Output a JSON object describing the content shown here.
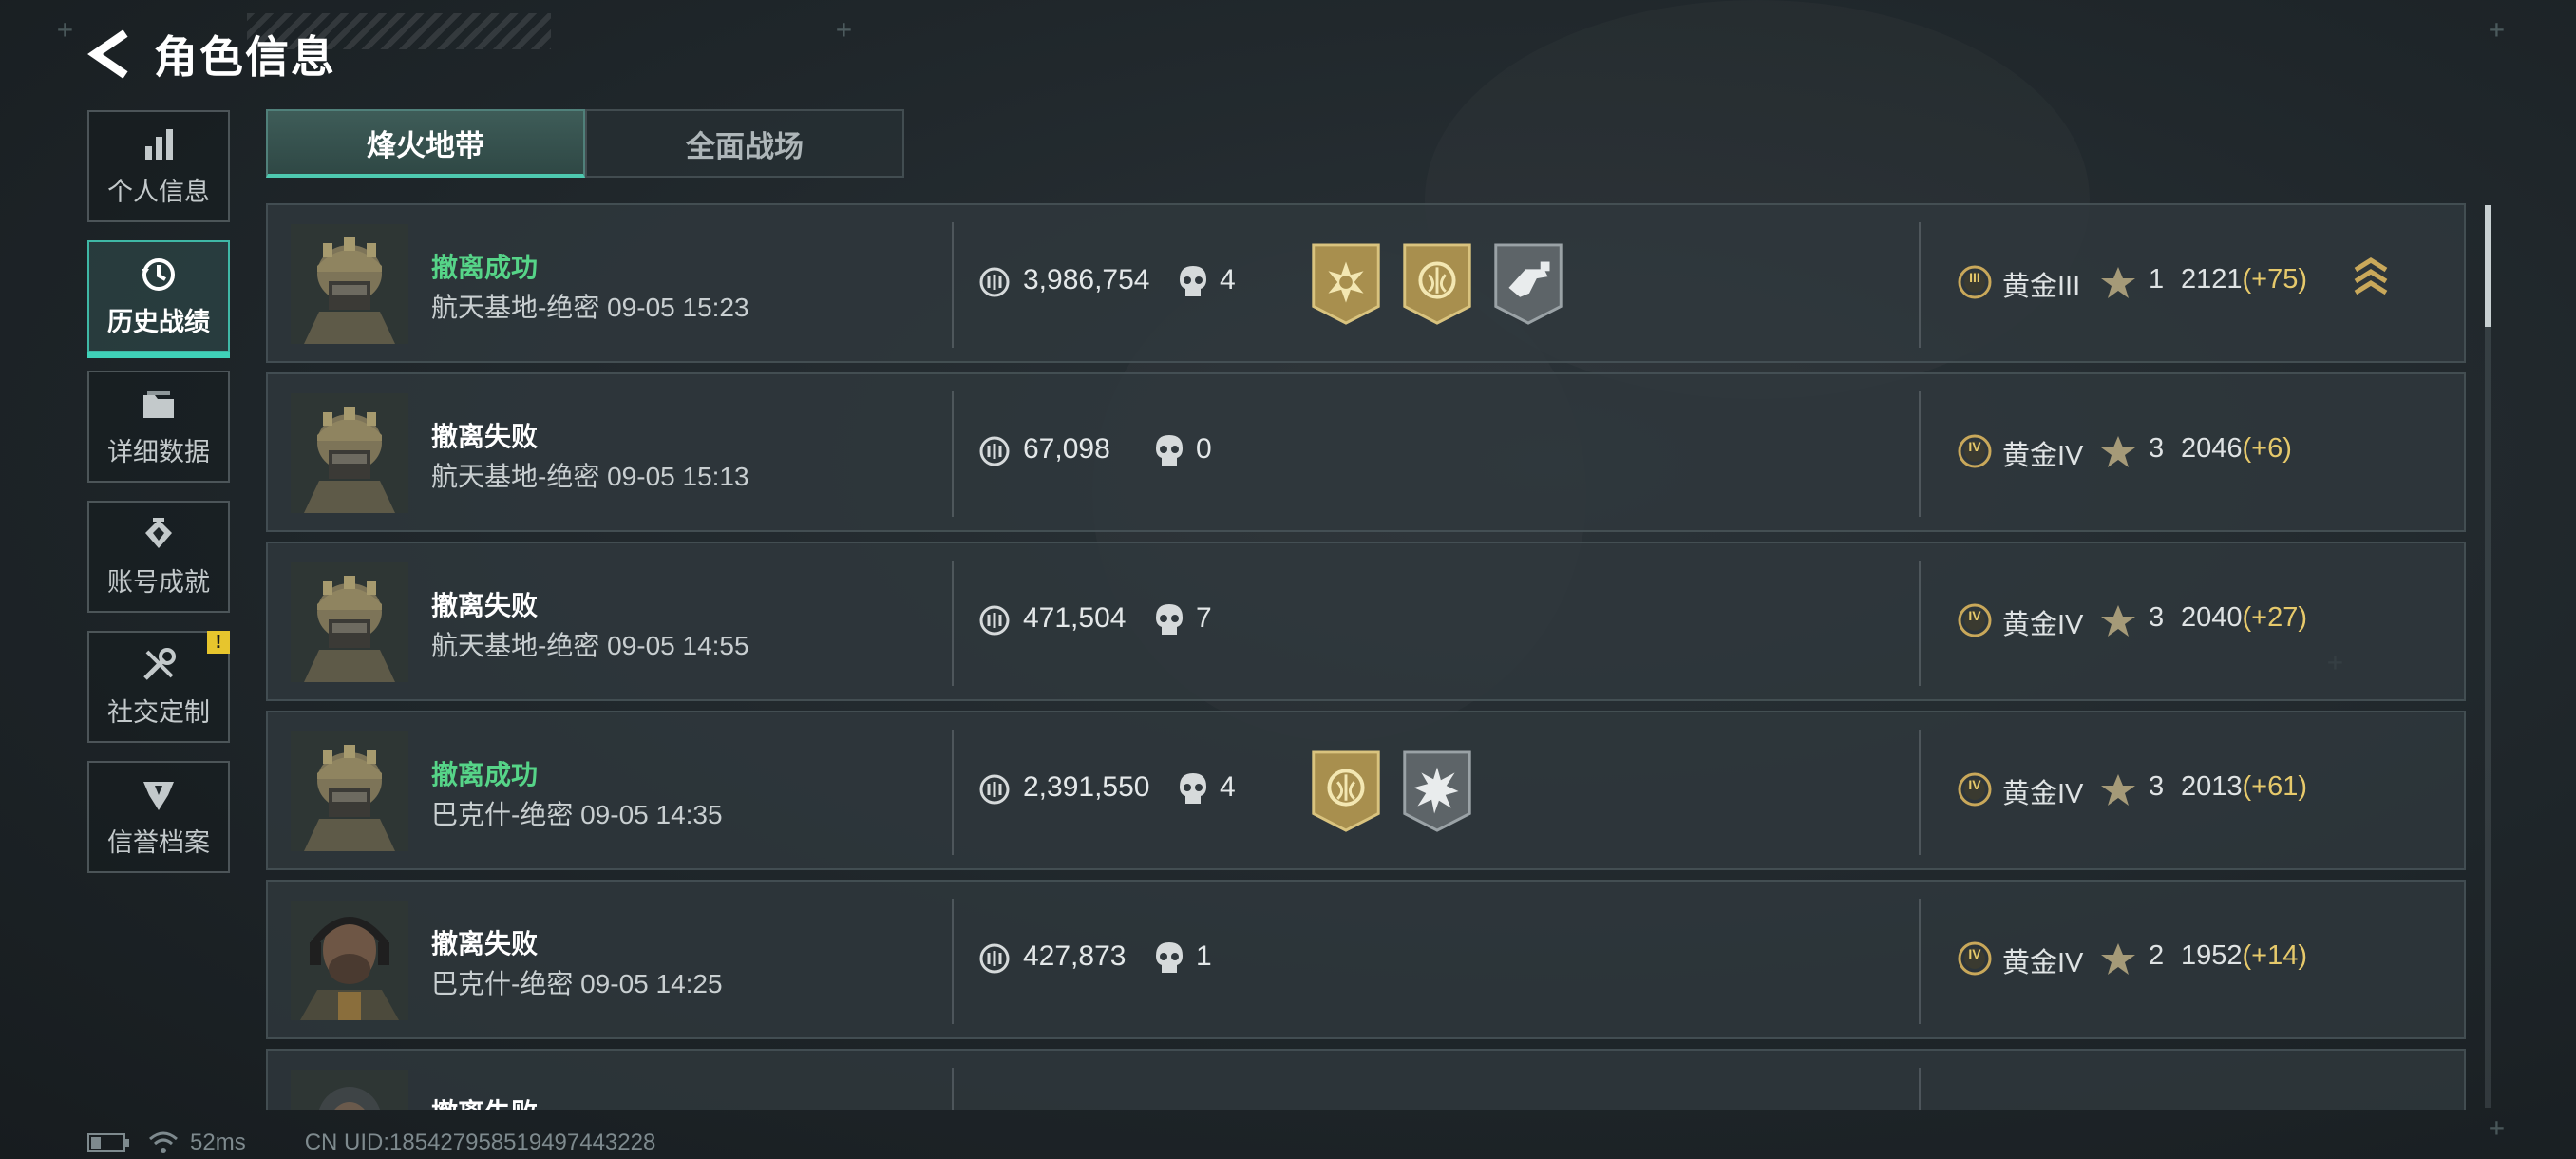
{
  "header": {
    "title": "角色信息"
  },
  "sidebar": {
    "items": [
      {
        "label": "个人信息",
        "icon": "bar-chart-icon"
      },
      {
        "label": "历史战绩",
        "icon": "history-clock-icon",
        "active": true
      },
      {
        "label": "详细数据",
        "icon": "folder-icon"
      },
      {
        "label": "账号成就",
        "icon": "achievement-icon"
      },
      {
        "label": "社交定制",
        "icon": "tools-icon",
        "badge": "!"
      },
      {
        "label": "信誉档案",
        "icon": "shield-emblem-icon"
      }
    ]
  },
  "tabs": [
    {
      "label": "烽火地带",
      "active": true
    },
    {
      "label": "全面战场",
      "active": false
    }
  ],
  "matches": [
    {
      "status": "撤离成功",
      "success": true,
      "map_time": "航天基地-绝密 09-05 15:23",
      "value": "3,986,754",
      "kills": "4",
      "badges": [
        "gold-sun-badge",
        "gold-emblem-badge",
        "grey-weapon-badge"
      ],
      "rank": "黄金III",
      "rank_numeral": "III",
      "stars": "1",
      "score": "2121",
      "delta": "(+75)",
      "rank_up": true,
      "avatar": "helmet-soldier"
    },
    {
      "status": "撤离失败",
      "success": false,
      "map_time": "航天基地-绝密 09-05 15:13",
      "value": "67,098",
      "kills": "0",
      "badges": [],
      "rank": "黄金IV",
      "rank_numeral": "IV",
      "stars": "3",
      "score": "2046",
      "delta": "(+6)",
      "rank_up": false,
      "avatar": "helmet-soldier"
    },
    {
      "status": "撤离失败",
      "success": false,
      "map_time": "航天基地-绝密 09-05 14:55",
      "value": "471,504",
      "kills": "7",
      "badges": [],
      "rank": "黄金IV",
      "rank_numeral": "IV",
      "stars": "3",
      "score": "2040",
      "delta": "(+27)",
      "rank_up": false,
      "avatar": "helmet-soldier"
    },
    {
      "status": "撤离成功",
      "success": true,
      "map_time": "巴克什-绝密 09-05 14:35",
      "value": "2,391,550",
      "kills": "4",
      "badges": [
        "gold-emblem-badge",
        "grey-burst-badge"
      ],
      "rank": "黄金IV",
      "rank_numeral": "IV",
      "stars": "3",
      "score": "2013",
      "delta": "(+61)",
      "rank_up": false,
      "avatar": "helmet-soldier"
    },
    {
      "status": "撤离失败",
      "success": false,
      "map_time": "巴克什-绝密 09-05 14:25",
      "value": "427,873",
      "kills": "1",
      "badges": [],
      "rank": "黄金IV",
      "rank_numeral": "IV",
      "stars": "2",
      "score": "1952",
      "delta": "(+14)",
      "rank_up": false,
      "avatar": "headset-operator"
    },
    {
      "status": "撤离失败",
      "success": false,
      "map_time": "",
      "value": "",
      "kills": "",
      "badges": [],
      "rank": "",
      "rank_numeral": "",
      "stars": "",
      "score": "",
      "delta": "",
      "rank_up": false,
      "avatar": "hooded-operator"
    }
  ],
  "footer": {
    "ping": "52ms",
    "uid": "CN UID:1854279585194974432​28"
  },
  "colors": {
    "success": "#56d488",
    "accent": "#4ec9b0",
    "gold": "#c9a85a",
    "delta": "#e6c96b"
  }
}
